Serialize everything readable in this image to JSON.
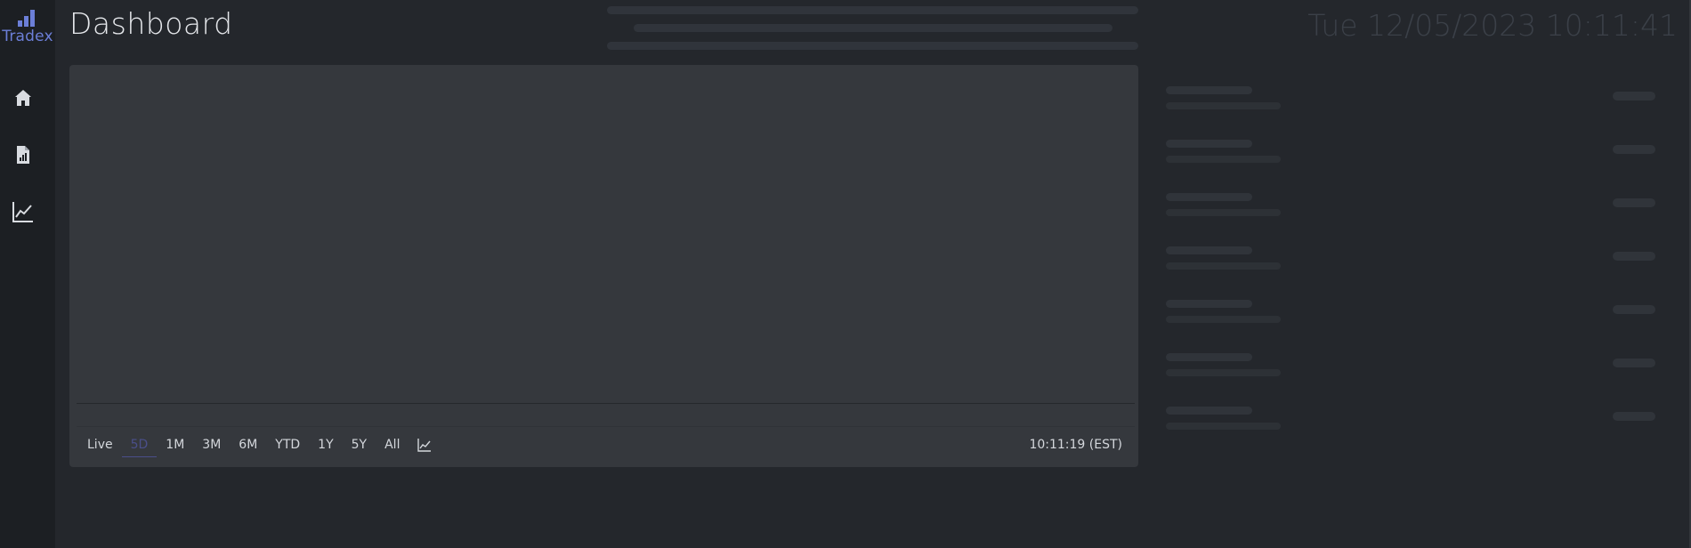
{
  "brand": {
    "name": "Tradex",
    "logo_icon": "bar-chart-icon",
    "accent": "#6c7fd8"
  },
  "nav": [
    {
      "id": "home",
      "icon": "home-icon"
    },
    {
      "id": "reports",
      "icon": "report-document-icon"
    },
    {
      "id": "analytics",
      "icon": "line-chart-icon"
    }
  ],
  "header": {
    "title": "Dashboard",
    "datetime": "Tue 12/05/2023 10:11:41"
  },
  "chart": {
    "ranges": [
      "Live",
      "5D",
      "1M",
      "3M",
      "6M",
      "YTD",
      "1Y",
      "5Y",
      "All"
    ],
    "active_range": "5D",
    "chart_type_icon": "line-chart-icon",
    "timestamp": "10:11:19 (EST)"
  },
  "watchlist": {
    "loading": true,
    "placeholder_rows": 7
  }
}
